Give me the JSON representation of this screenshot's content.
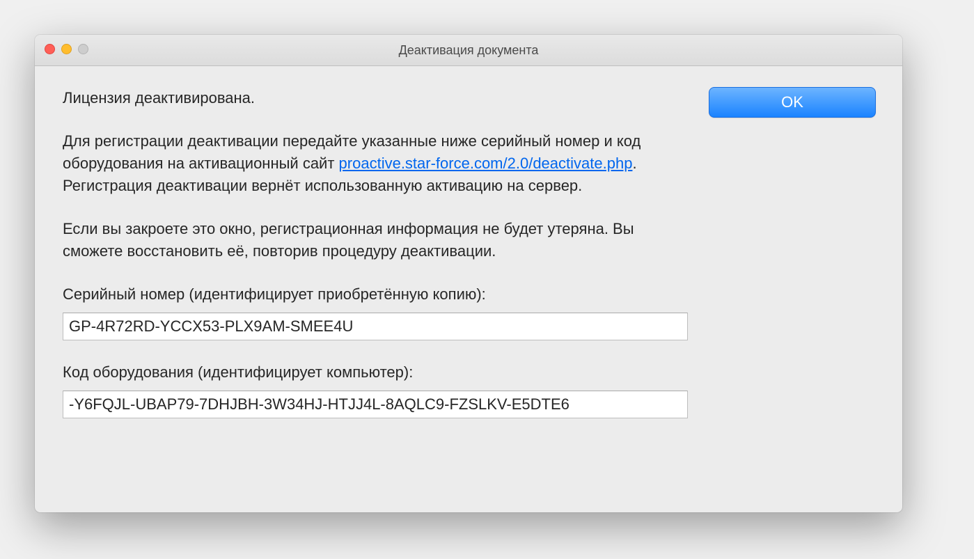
{
  "titlebar": {
    "title": "Деактивация документа"
  },
  "body": {
    "status": "Лицензия деактивирована.",
    "instruction_prefix": "Для регистрации деактивации передайте указанные ниже серийный номер и код оборудования на активационный сайт ",
    "instruction_link": "proactive.star-force.com/2.0/deactivate.php",
    "instruction_suffix": ". Регистрация деактивации вернёт использованную активацию на сервер.",
    "recovery_note": "Если вы закроете это окно, регистрационная информация не будет утеряна. Вы сможете восстановить её, повторив процедуру деактивации.",
    "serial_label": "Серийный номер (идентифицирует приобретённую копию):",
    "serial_value": "GP-4R72RD-YCCX53-PLX9AM-SMEE4U",
    "hwcode_label": "Код оборудования (идентифицирует компьютер):",
    "hwcode_value": "-Y6FQJL-UBAP79-7DHJBH-3W34HJ-HTJJ4L-8AQLC9-FZSLKV-E5DTE6"
  },
  "buttons": {
    "ok_label": "OK"
  }
}
